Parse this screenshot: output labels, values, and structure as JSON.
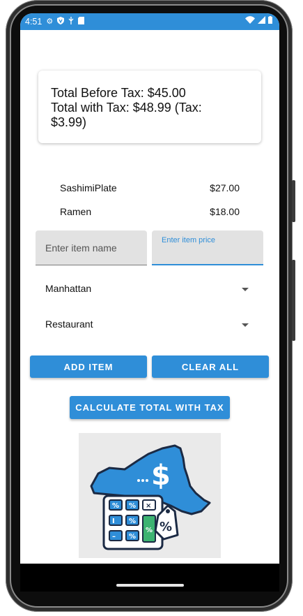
{
  "status_bar": {
    "time": "4:51"
  },
  "summary": {
    "line1": "Total Before Tax: $45.00",
    "line2": "Total with Tax: $48.99 (Tax:",
    "line3": "$3.99)"
  },
  "items": [
    {
      "name": "SashimiPlate",
      "price": "$27.00"
    },
    {
      "name": "Ramen",
      "price": "$18.00"
    }
  ],
  "inputs": {
    "name_placeholder": "Enter item name",
    "price_label": "Enter item price"
  },
  "dropdowns": {
    "location": "Manhattan",
    "category": "Restaurant"
  },
  "buttons": {
    "add": "ADD ITEM",
    "clear": "CLEAR ALL",
    "calculate": "CALCULATE TOTAL WITH TAX"
  },
  "colors": {
    "accent": "#2f8ed8",
    "field_bg": "#e2e2e2"
  }
}
